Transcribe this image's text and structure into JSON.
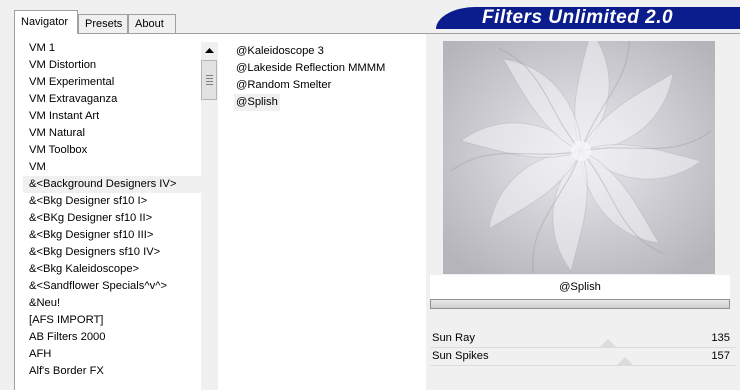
{
  "tabs": [
    {
      "label": "Navigator",
      "active": true
    },
    {
      "label": "Presets",
      "active": false
    },
    {
      "label": "About",
      "active": false
    }
  ],
  "banner": {
    "title": "Filters Unlimited 2.0",
    "color": "#0b1d8c"
  },
  "categories": [
    "VM 1",
    "VM Distortion",
    "VM Experimental",
    "VM Extravaganza",
    "VM Instant Art",
    "VM Natural",
    "VM Toolbox",
    "VM",
    "&<Background Designers IV>",
    "&<Bkg Designer sf10 I>",
    "&<BKg Designer sf10 II>",
    "&<Bkg Designer sf10 III>",
    "&<Bkg Designers sf10 IV>",
    "&<Bkg Kaleidoscope>",
    "&<Sandflower Specials^v^>",
    "&Neu!",
    "[AFS IMPORT]",
    "AB Filters 2000",
    "AFH",
    "Alf's Border FX"
  ],
  "selected_category": "&<Background Designers IV>",
  "filters": [
    "@Kaleidoscope 3",
    "@Lakeside Reflection MMMM",
    "@Random Smelter",
    "@Splish"
  ],
  "selected_filter": "@Splish",
  "preview": {
    "filter_name": "@Splish",
    "progress": 1.0
  },
  "sliders": [
    {
      "label": "Sun Ray",
      "value": "135",
      "max": 255
    },
    {
      "label": "Sun Spikes",
      "value": "157",
      "max": 255
    }
  ],
  "icons": {
    "scroll_up": "triangle-up-icon"
  }
}
